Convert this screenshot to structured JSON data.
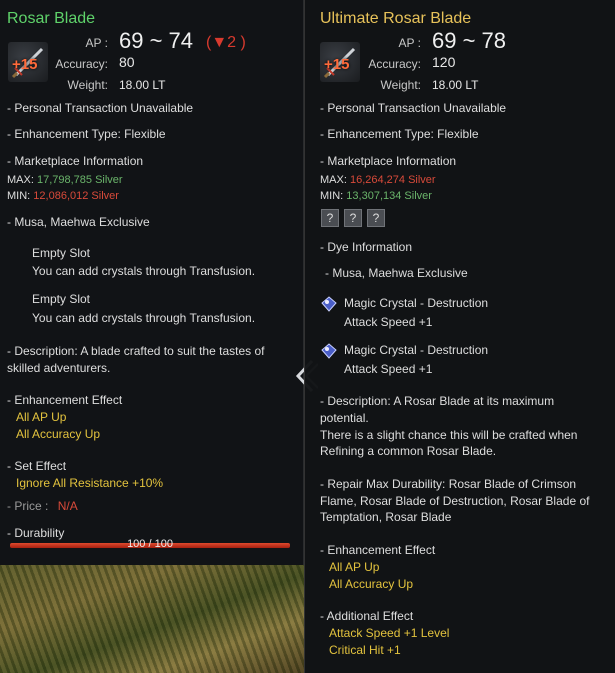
{
  "left": {
    "name": "Rosar Blade",
    "enhancement": "+15",
    "stats": {
      "ap_label": "AP :",
      "ap_value": "69 ~ 74",
      "ap_change": "(▼2 )",
      "accuracy_label": "Accuracy:",
      "accuracy_value": "80",
      "weight_label": "Weight:",
      "weight_value": "18.00 LT"
    },
    "transaction": "- Personal Transaction Unavailable",
    "enhancement_type": "- Enhancement Type: Flexible",
    "marketplace_heading": "- Marketplace Information",
    "max_label": "MAX:",
    "max_value": "17,798,785 Silver",
    "min_label": "MIN:",
    "min_value": "12,086,012 Silver",
    "exclusive": "- Musa, Maehwa Exclusive",
    "slots": [
      {
        "title": "Empty Slot",
        "desc": "You can add crystals through Transfusion."
      },
      {
        "title": "Empty Slot",
        "desc": "You can add crystals through Transfusion."
      }
    ],
    "description_1": "- Description: A blade crafted to suit the tastes of",
    "description_2": "skilled adventurers.",
    "enhancement_effect_heading": "- Enhancement Effect",
    "enhancement_effects": [
      "All AP Up",
      "All Accuracy Up"
    ],
    "set_effect_heading": "- Set Effect",
    "set_effect": "Ignore All Resistance +10%",
    "price_label": "- Price :",
    "price_value": "N/A",
    "durability_label": "- Durability",
    "durability_text": "100 / 100",
    "durability_fraction": 1.0
  },
  "right": {
    "name": "Ultimate Rosar Blade",
    "enhancement": "+15",
    "stats": {
      "ap_label": "AP :",
      "ap_value": "69 ~ 78",
      "accuracy_label": "Accuracy:",
      "accuracy_value": "120",
      "weight_label": "Weight:",
      "weight_value": "18.00 LT"
    },
    "transaction": "- Personal Transaction Unavailable",
    "enhancement_type": "- Enhancement Type: Flexible",
    "marketplace_heading": "- Marketplace Information",
    "max_label": "MAX:",
    "max_value": "16,264,274 Silver",
    "min_label": "MIN:",
    "min_value": "13,307,134 Silver",
    "dye_slots": [
      "?",
      "?",
      "?"
    ],
    "dye_heading": "- Dye Information",
    "exclusive": "- Musa, Maehwa Exclusive",
    "crystals": [
      {
        "name": "Magic Crystal - Destruction",
        "effect": "Attack Speed +1"
      },
      {
        "name": "Magic Crystal - Destruction",
        "effect": "Attack Speed +1"
      }
    ],
    "description_lines": [
      "- Description: A Rosar Blade at its maximum",
      "potential.",
      "There is a slight chance this will be crafted when",
      "Refining a common Rosar Blade."
    ],
    "repair_lines": [
      "- Repair Max Durability: Rosar Blade of Crimson",
      "Flame, Rosar Blade of Destruction, Rosar Blade of",
      "Temptation, Rosar Blade"
    ],
    "enhancement_effect_heading": "- Enhancement Effect",
    "enhancement_effects": [
      "All AP Up",
      "All Accuracy Up"
    ],
    "additional_effect_heading": "- Additional Effect",
    "additional_effects": [
      "Attack Speed +1 Level",
      "Critical Hit +1"
    ]
  },
  "colors": {
    "green_name": "#5fd26a",
    "gold_name": "#e7c25a",
    "yellow": "#e3c33e",
    "red": "#d84a3a",
    "green": "#6ab46a"
  }
}
